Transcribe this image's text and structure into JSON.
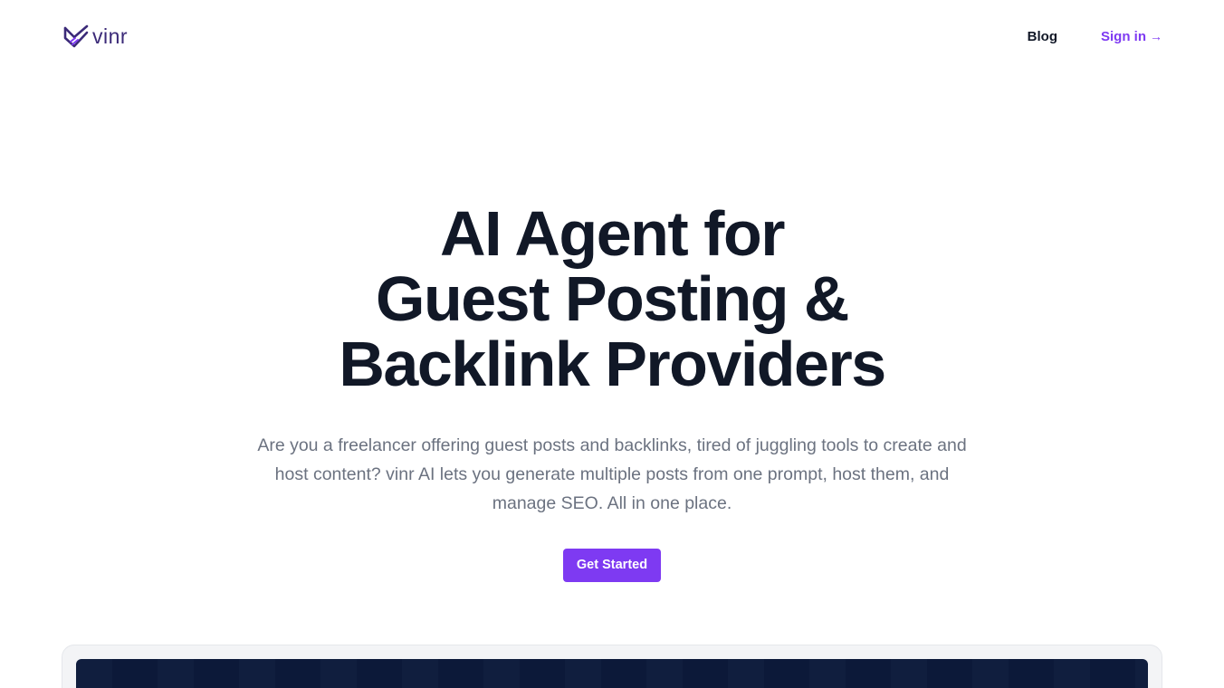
{
  "brand": {
    "name": "vinr",
    "accent_color": "#7e3af2",
    "logo_color": "#3b2a78"
  },
  "nav": {
    "blog_label": "Blog",
    "signin_label": "Sign in",
    "signin_icon": "arrow-right-icon"
  },
  "hero": {
    "title_lines": [
      "AI Agent for",
      "Guest Posting &",
      "Backlink Providers"
    ],
    "description": "Are you a freelancer offering guest posts and backlinks, tired of juggling tools to create and host content? vinr AI lets you generate multiple posts from one prompt, host them, and manage SEO. All in one place.",
    "cta_label": "Get Started"
  }
}
